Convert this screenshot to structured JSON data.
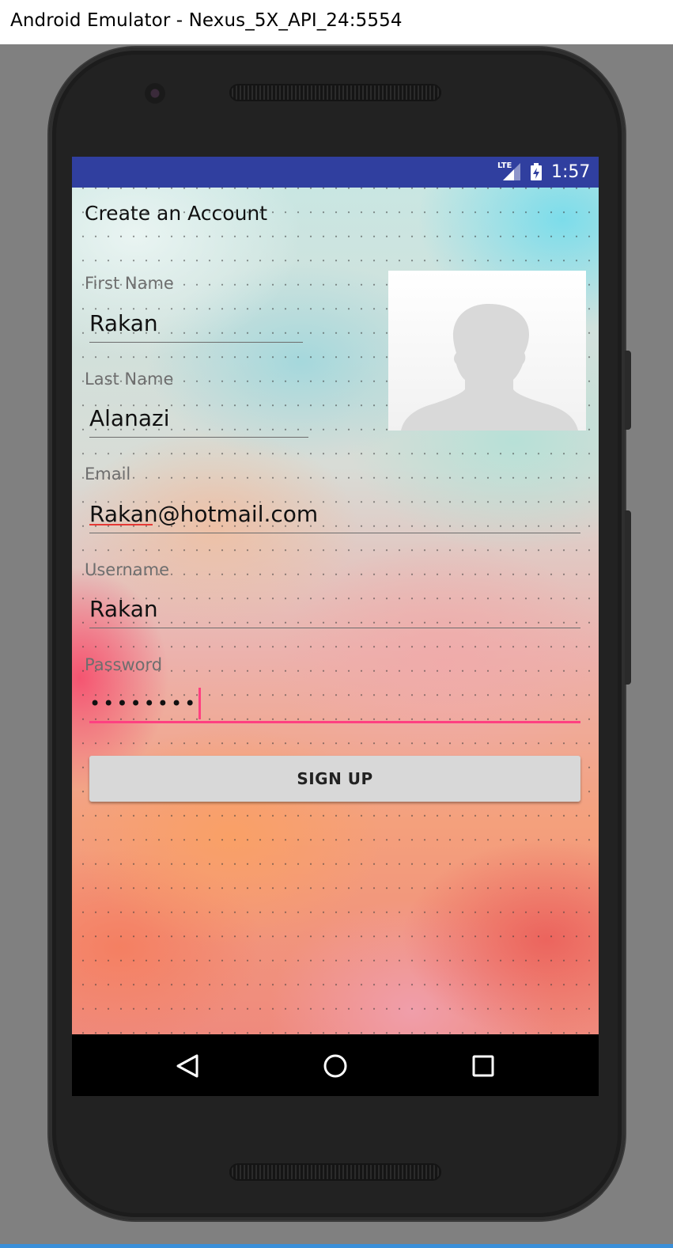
{
  "window": {
    "title": "Android Emulator - Nexus_5X_API_24:5554"
  },
  "status_bar": {
    "network": "LTE",
    "time": "1:57",
    "icons": [
      "signal-icon",
      "battery-icon"
    ]
  },
  "app": {
    "title": "Create an Account",
    "fields": {
      "first_name": {
        "label": "First Name",
        "value": "Rakan"
      },
      "last_name": {
        "label": "Last Name",
        "value": "Alanazi"
      },
      "email": {
        "label": "Email",
        "value": "Rakan@hotmail.com"
      },
      "username": {
        "label": "Username",
        "value": "Rakan"
      },
      "password": {
        "label": "Password",
        "value": "••••••••"
      }
    },
    "avatar_icon": "person-silhouette-icon",
    "signup_label": "SIGN UP",
    "accent_color": "#ff4081",
    "status_bar_color": "#303f9f"
  },
  "nav_bar": {
    "icons": [
      "back-icon",
      "home-icon",
      "recents-icon"
    ]
  }
}
